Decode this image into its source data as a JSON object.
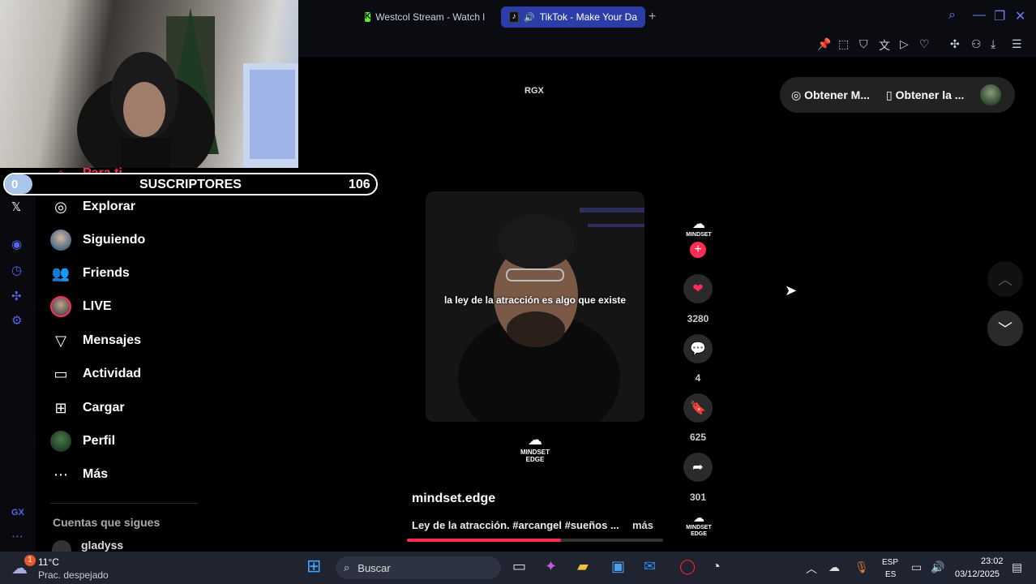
{
  "browser": {
    "tabs": [
      {
        "label": "Westcol Stream - Watch l",
        "icon": "kick-logo"
      },
      {
        "label": "TikTok - Make Your Da",
        "icon": "tiktok-logo",
        "active": true
      }
    ],
    "new_tab": "+"
  },
  "overlay": {
    "sub_counter": {
      "current": "0",
      "label": "SUSCRIPTORES",
      "goal": "106"
    },
    "rgx_label": "RGX"
  },
  "sidebar": {
    "items": [
      {
        "label": "Para ti",
        "icon": "home-icon"
      },
      {
        "label": "Explorar",
        "icon": "compass-icon"
      },
      {
        "label": "Siguiendo",
        "icon": "avatar-icon"
      },
      {
        "label": "Friends",
        "icon": "friends-icon"
      },
      {
        "label": "LIVE",
        "icon": "live-icon"
      },
      {
        "label": "Mensajes",
        "icon": "send-icon"
      },
      {
        "label": "Actividad",
        "icon": "activity-icon"
      },
      {
        "label": "Cargar",
        "icon": "upload-icon"
      },
      {
        "label": "Perfil",
        "icon": "profile-icon"
      },
      {
        "label": "Más",
        "icon": "more-icon"
      }
    ],
    "following_title": "Cuentas que sigues",
    "following": [
      {
        "label": "gladyss"
      }
    ]
  },
  "video": {
    "caption_overlay": "la ley de la atracción es algo que existe",
    "watermark_lines": [
      "MINDSET",
      "EDGE"
    ],
    "username": "mindset.edge",
    "description": "Ley de la atracción. #arcangel #sueños ...",
    "more": "más",
    "progress": 0.6
  },
  "actions": {
    "creator_badge": "MINDSET",
    "likes": "3280",
    "comments": "4",
    "saves": "625",
    "shares": "301",
    "next_badge_lines": [
      "MINDSET",
      "EDGE"
    ]
  },
  "get_app": {
    "btn1": "Obtener M...",
    "btn2": "Obtener la ..."
  },
  "taskbar": {
    "weather_temp": "11°C",
    "weather_desc": "Prac. despejado",
    "search_placeholder": "Buscar",
    "lang1": "ESP",
    "lang2": "ES",
    "time": "23:02",
    "date": "03/12/2025",
    "weather_badge": "1"
  },
  "colors": {
    "accent": "#fe2c55",
    "opera_blue": "#5165e8",
    "tab_active": "#2b3ea8",
    "taskbar_bg": "#1f2430"
  }
}
